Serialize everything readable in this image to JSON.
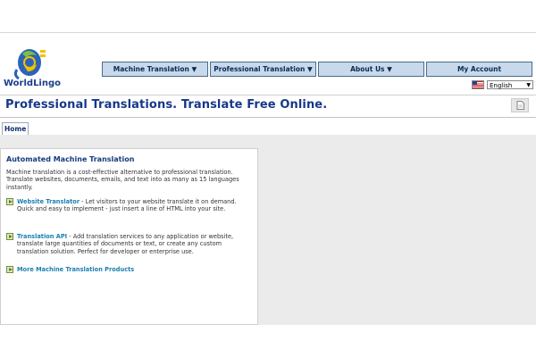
{
  "brand": {
    "logo_text_world": "World",
    "logo_text_lingo": "Lingo"
  },
  "nav": {
    "items": [
      {
        "label": "Machine Translation ▼"
      },
      {
        "label": "Professional Translation ▼"
      },
      {
        "label": "About Us ▼"
      },
      {
        "label": "My Account"
      }
    ]
  },
  "language": {
    "selected": "English"
  },
  "header": {
    "headline": "Professional Translations. Translate Free Online."
  },
  "tabs": {
    "home": "Home"
  },
  "panel": {
    "title": "Automated Machine Translation",
    "intro": "Machine translation is a cost-effective alternative to professional translation. Translate websites, documents, emails, and text into as many as 15 languages instantly.",
    "items": [
      {
        "link": "Website Translator",
        "text": " - Let visitors to your website translate it on demand. Quick and easy to implement - just insert a line of HTML into your site."
      },
      {
        "link": "Translation API",
        "text": " - Add translation services to any application or website, translate large quantities of documents or text, or create any custom translation solution. Perfect for developer or enterprise use."
      }
    ],
    "more_link": "More Machine Translation Products"
  },
  "colors": {
    "accent": "#16378a",
    "link": "#1b7fb0",
    "nav_bg": "#c7d9ea"
  }
}
